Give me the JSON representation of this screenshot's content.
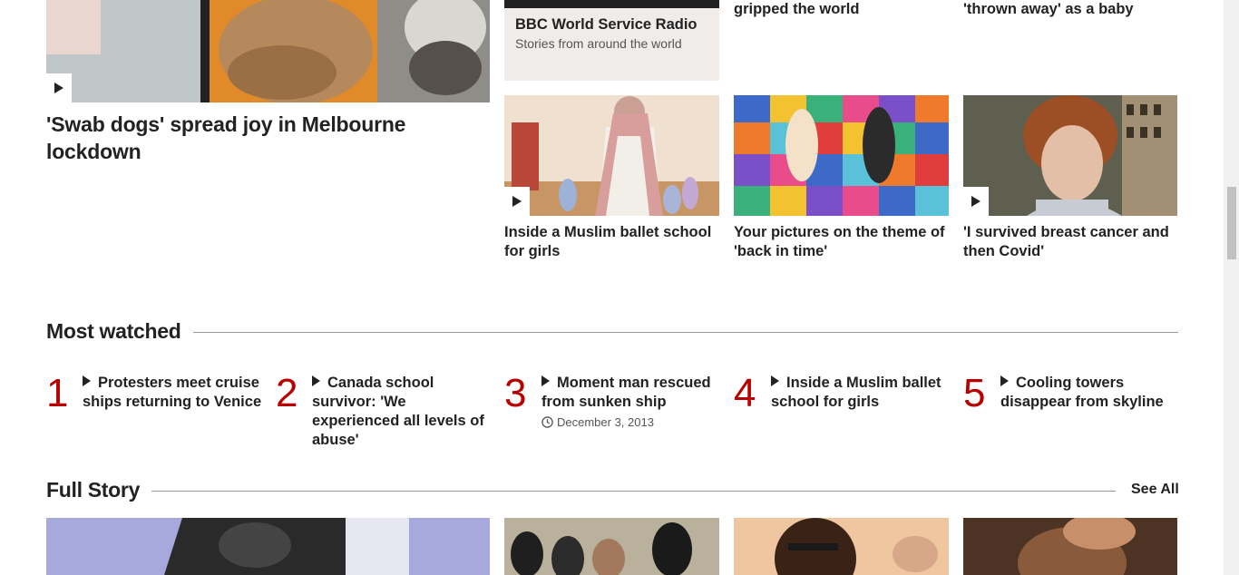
{
  "top_feature": {
    "headline": "'Swab dogs' spread joy in Melbourne lockdown"
  },
  "radio_card": {
    "title": "BBC World Service Radio",
    "subtitle": "Stories from around the world"
  },
  "top_clipped": {
    "col3": "gripped the world",
    "col4": "'thrown away' as a baby"
  },
  "cards": [
    {
      "headline": "Inside a Muslim ballet school for girls",
      "video": true
    },
    {
      "headline": "Your pictures on the theme of 'back in time'",
      "video": false
    },
    {
      "headline": "'I survived breast cancer and then Covid'",
      "video": true
    }
  ],
  "most_watched": {
    "title": "Most watched",
    "items": [
      {
        "rank": "1",
        "text": "Protesters meet cruise ships returning to Venice",
        "date": ""
      },
      {
        "rank": "2",
        "text": "Canada school survivor: 'We experienced all levels of abuse'",
        "date": ""
      },
      {
        "rank": "3",
        "text": "Moment man rescued from sunken ship",
        "date": "December 3, 2013"
      },
      {
        "rank": "4",
        "text": "Inside a Muslim ballet school for girls",
        "date": ""
      },
      {
        "rank": "5",
        "text": "Cooling towers disappear from skyline",
        "date": ""
      }
    ]
  },
  "full_story": {
    "title": "Full Story",
    "see_all": "See All"
  },
  "icons": {
    "play": "play-icon",
    "clock": "clock-icon"
  },
  "colors": {
    "accent_red": "#b80000",
    "text": "#222222",
    "rule": "#9a9a9a",
    "radio_card_bg": "#efecea"
  }
}
